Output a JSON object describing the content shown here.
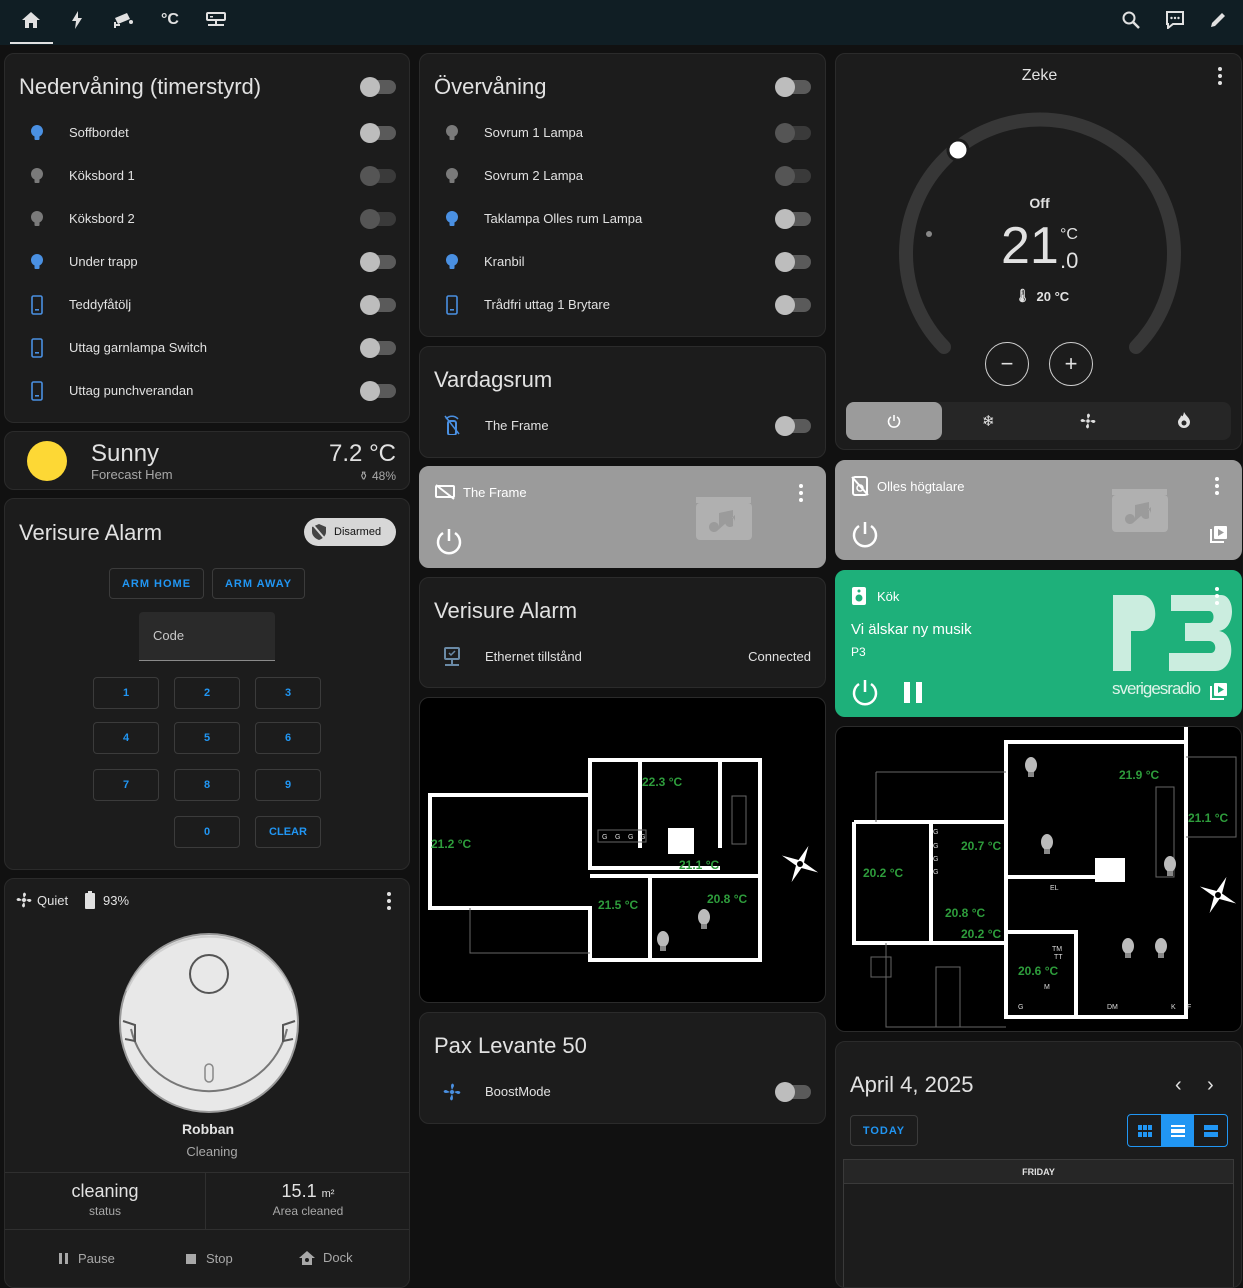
{
  "topbar": {
    "icons": [
      "home-icon",
      "lightning-icon",
      "cctv-icon",
      "thermometer-celsius-icon",
      "network-icon"
    ],
    "celsius_glyph": "°C",
    "right_icons": [
      "search-icon",
      "chat-icon",
      "pencil-icon"
    ]
  },
  "nedervaning": {
    "title": "Nedervåning (timerstyrd)",
    "items": [
      {
        "label": "Soffbordet",
        "icon": "bulb-on"
      },
      {
        "label": "Köksbord 1",
        "icon": "bulb-off"
      },
      {
        "label": "Köksbord 2",
        "icon": "bulb-off"
      },
      {
        "label": "Under trapp",
        "icon": "bulb-on"
      },
      {
        "label": "Teddyfåtölj",
        "icon": "switch"
      },
      {
        "label": "Uttag garnlampa Switch",
        "icon": "switch"
      },
      {
        "label": "Uttag punchverandan",
        "icon": "switch"
      }
    ]
  },
  "weather": {
    "condition": "Sunny",
    "source": "Forecast Hem",
    "temperature": "7.2",
    "unit": "°C",
    "humidity": "48%"
  },
  "alarm1": {
    "title": "Verisure Alarm",
    "status": "Disarmed",
    "arm_home": "ARM HOME",
    "arm_away": "ARM AWAY",
    "code_label": "Code",
    "keys": [
      "1",
      "2",
      "3",
      "4",
      "5",
      "6",
      "7",
      "8",
      "9",
      "0",
      "CLEAR"
    ]
  },
  "vacuum": {
    "fan_mode": "Quiet",
    "battery": "93%",
    "name": "Robban",
    "state": "Cleaning",
    "stat1_value": "cleaning",
    "stat1_label": "status",
    "stat2_value": "15.1",
    "stat2_unit": "m²",
    "stat2_label": "Area cleaned",
    "pause": "Pause",
    "stop": "Stop",
    "dock": "Dock"
  },
  "overvaning": {
    "title": "Övervåning",
    "items": [
      {
        "label": "Sovrum 1 Lampa",
        "icon": "bulb-off"
      },
      {
        "label": "Sovrum 2 Lampa",
        "icon": "bulb-off"
      },
      {
        "label": "Taklampa Olles rum Lampa",
        "icon": "bulb-on"
      },
      {
        "label": "Kranbil",
        "icon": "bulb-on"
      },
      {
        "label": "Trådfri uttag 1 Brytare",
        "icon": "switch"
      }
    ]
  },
  "vardagsrum": {
    "title": "Vardagsrum",
    "item": "The Frame"
  },
  "media_frame": {
    "name": "The Frame"
  },
  "alarm2": {
    "title": "Verisure Alarm",
    "row_label": "Ethernet tillstånd",
    "row_value": "Connected"
  },
  "floor1": {
    "temps": [
      "22.3 °C",
      "21.2 °C",
      "21.1 °C",
      "21.5 °C",
      "20.8 °C"
    ]
  },
  "pax": {
    "title": "Pax Levante 50",
    "item": "BoostMode"
  },
  "thermostat": {
    "name": "Zeke",
    "state": "Off",
    "temp_int": "21",
    "temp_dec": ".0",
    "unit": "°C",
    "current": "20 °C"
  },
  "media_olle": {
    "name": "Olles högtalare"
  },
  "media_kok": {
    "name": "Kök",
    "title": "Vi älskar ny musik",
    "channel": "P3",
    "logo_text": "sverigesradio"
  },
  "floor2": {
    "temps": [
      "21.9 °C",
      "21.1 °C",
      "20.7 °C",
      "20.2 °C",
      "20.8 °C",
      "20.2 °C",
      "20.6 °C"
    ]
  },
  "calendar": {
    "date": "April 4, 2025",
    "today": "TODAY",
    "day_header": "FRIDAY"
  },
  "colors": {
    "accent": "#2196f3",
    "bulb_on": "#4a90e2",
    "green": "#1eb07a",
    "temp_green": "#2e9d3c"
  }
}
